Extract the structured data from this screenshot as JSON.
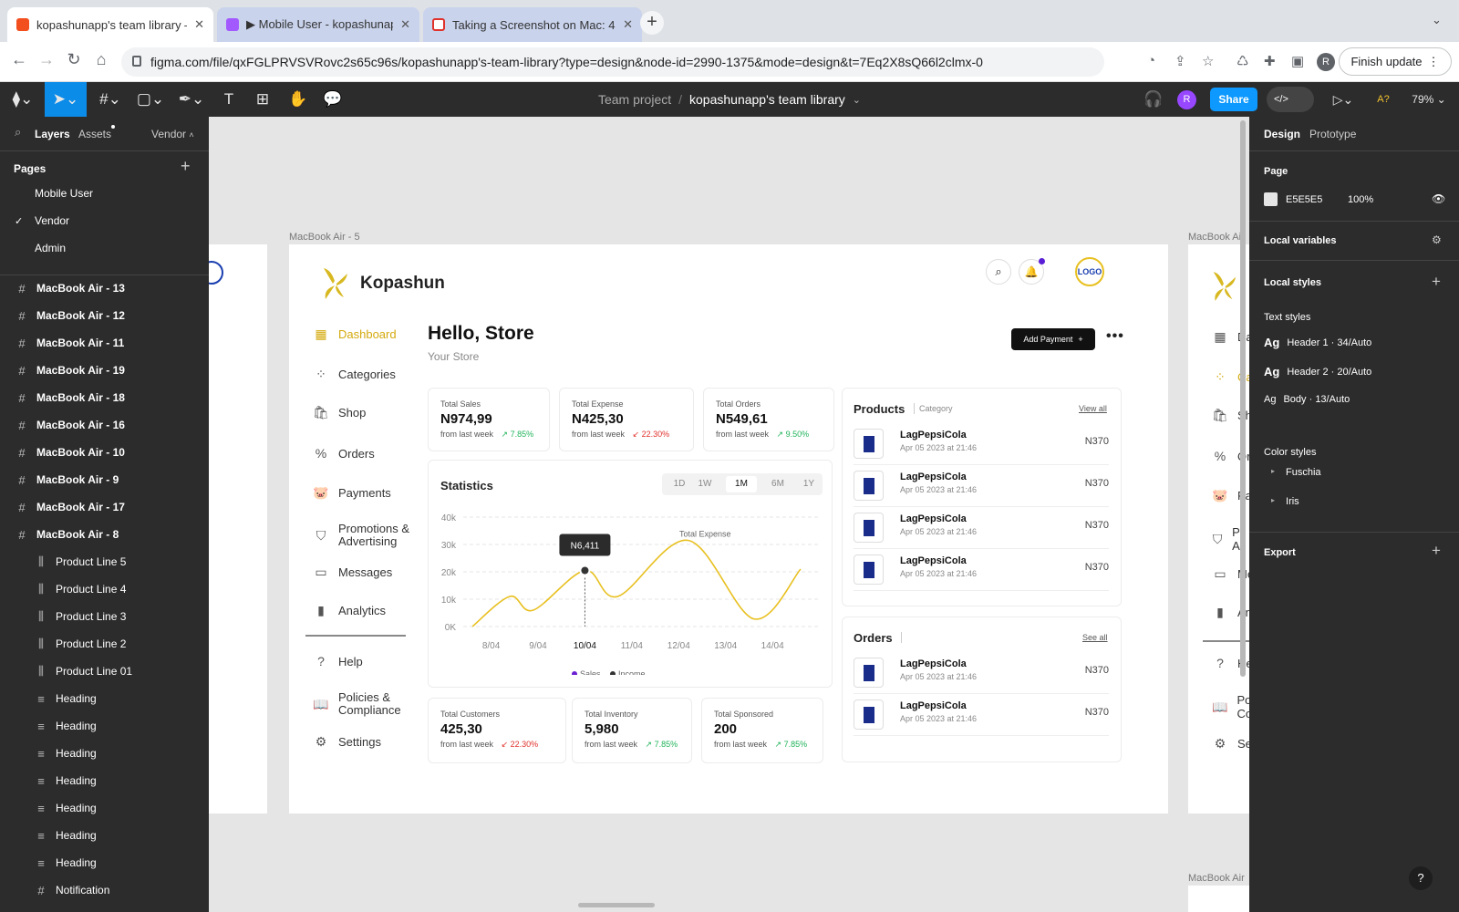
{
  "browser": {
    "tabs": [
      {
        "title": "kopashunapp's team library – F",
        "fav": "#f24e1e"
      },
      {
        "title": "▶ Mobile User - kopashunapp'",
        "fav": "#a259ff"
      },
      {
        "title": "Taking a Screenshot on Mac: 4",
        "fav": "#e0312b"
      }
    ],
    "url": "figma.com/file/qxFGLPRVSVRovc2s65c96s/kopashunapp's-team-library?type=design&node-id=2990-1375&mode=design&t=7Eq2X8sQ66l2clmx-0",
    "finish_update": "Finish update",
    "profile": "R"
  },
  "toolbar": {
    "project": "Team project",
    "separator": "/",
    "file": "kopashunapp's team library",
    "share": "Share",
    "user": "R",
    "zoom": "79%",
    "a_label": "A?"
  },
  "left_panel": {
    "tab_layers": "Layers",
    "tab_assets": "Assets",
    "page_switch": "Vendor",
    "pages_title": "Pages",
    "pages": [
      "Mobile User",
      "Vendor",
      "Admin"
    ],
    "layers": [
      {
        "name": "MacBook Air - 13",
        "type": "frame"
      },
      {
        "name": "MacBook Air - 12",
        "type": "frame"
      },
      {
        "name": "MacBook Air - 11",
        "type": "frame"
      },
      {
        "name": "MacBook Air - 19",
        "type": "frame"
      },
      {
        "name": "MacBook Air - 18",
        "type": "frame"
      },
      {
        "name": "MacBook Air - 16",
        "type": "frame"
      },
      {
        "name": "MacBook Air - 10",
        "type": "frame"
      },
      {
        "name": "MacBook Air - 9",
        "type": "frame"
      },
      {
        "name": "MacBook Air - 17",
        "type": "frame"
      },
      {
        "name": "MacBook Air - 8",
        "type": "frame"
      },
      {
        "name": "Product Line 5",
        "type": "component"
      },
      {
        "name": "Product Line 4",
        "type": "component"
      },
      {
        "name": "Product Line 3",
        "type": "component"
      },
      {
        "name": "Product Line 2",
        "type": "component"
      },
      {
        "name": "Product Line 01",
        "type": "component"
      },
      {
        "name": "Heading",
        "type": "text"
      },
      {
        "name": "Heading",
        "type": "text"
      },
      {
        "name": "Heading",
        "type": "text"
      },
      {
        "name": "Heading",
        "type": "text"
      },
      {
        "name": "Heading",
        "type": "text"
      },
      {
        "name": "Heading",
        "type": "text"
      },
      {
        "name": "Heading",
        "type": "text"
      },
      {
        "name": "Notification",
        "type": "frame"
      }
    ]
  },
  "canvas": {
    "frame_label": "MacBook Air - 5",
    "frame_label_right": "MacBook Air -",
    "frame_label_bottom": "MacBook Air -",
    "brand": "Kopashun",
    "logo_text": "LOGO",
    "greeting": "Hello, Store",
    "subtitle": "Your Store",
    "add_payment": "Add Payment",
    "nav": [
      "Dashboard",
      "Categories",
      "Shop",
      "Orders",
      "Payments",
      "Promotions & Advertising",
      "Messages",
      "Analytics"
    ],
    "nav_bottom": [
      "Help",
      "Policies & Compliance",
      "Settings"
    ],
    "right_nav_partial": [
      "Da",
      "Ca",
      "Sho",
      "Or",
      "Pa",
      "Pr Ac",
      "Me",
      "An",
      "He",
      "Po Co",
      "Se"
    ],
    "stats_top": [
      {
        "label": "Total Sales",
        "value": "N974,99",
        "from": "from last week",
        "change": "↗ 7.85%",
        "dir": "up"
      },
      {
        "label": "Total Expense",
        "value": "N425,30",
        "from": "from last week",
        "change": "↙ 22.30%",
        "dir": "dn"
      },
      {
        "label": "Total Orders",
        "value": "N549,61",
        "from": "from last week",
        "change": "↗ 9.50%",
        "dir": "up"
      }
    ],
    "stats_bottom": [
      {
        "label": "Total Customers",
        "value": "425,30",
        "from": "from last week",
        "change": "↙ 22.30%",
        "dir": "dn"
      },
      {
        "label": "Total Inventory",
        "value": "5,980",
        "from": "from last week",
        "change": "↗ 7.85%",
        "dir": "up"
      },
      {
        "label": "Total Sponsored",
        "value": "200",
        "from": "from last week",
        "change": "↗ 7.85%",
        "dir": "up"
      }
    ],
    "statistics": {
      "title": "Statistics",
      "ranges": [
        "1D",
        "1W",
        "1M",
        "6M",
        "1Y"
      ],
      "active_range": "1M",
      "tooltip": "N6,411",
      "annotation": "Total Expense",
      "legend": [
        "Sales",
        "Income"
      ]
    },
    "products": {
      "title": "Products",
      "category": "Category",
      "view_all": "View all",
      "items": [
        {
          "name": "LagPepsiCola",
          "date": "Apr 05 2023 at 21:46",
          "price": "N370"
        },
        {
          "name": "LagPepsiCola",
          "date": "Apr 05 2023 at 21:46",
          "price": "N370"
        },
        {
          "name": "LagPepsiCola",
          "date": "Apr 05 2023 at 21:46",
          "price": "N370"
        },
        {
          "name": "LagPepsiCola",
          "date": "Apr 05 2023 at 21:46",
          "price": "N370"
        }
      ]
    },
    "orders": {
      "title": "Orders",
      "see_all": "See all",
      "items": [
        {
          "name": "LagPepsiCola",
          "date": "Apr 05 2023 at 21:46",
          "price": "N370"
        },
        {
          "name": "LagPepsiCola",
          "date": "Apr 05 2023 at 21:46",
          "price": "N370"
        }
      ]
    }
  },
  "chart_data": {
    "type": "line",
    "x": [
      "8/04",
      "9/04",
      "10/04",
      "11/04",
      "12/04",
      "13/04",
      "14/04"
    ],
    "ylim": [
      0,
      40000
    ],
    "yticks": [
      "40k",
      "30k",
      "20k",
      "10k",
      "0K"
    ],
    "series": [
      {
        "name": "Sales",
        "color": "#e8c020",
        "points": [
          [
            7.6,
            0
          ],
          [
            8.4,
            11000
          ],
          [
            8.9,
            6000
          ],
          [
            10.0,
            20500
          ],
          [
            10.7,
            11000
          ],
          [
            12.2,
            31500
          ],
          [
            13.6,
            2800
          ],
          [
            14.6,
            21000
          ]
        ]
      }
    ],
    "legend_colors": [
      "#6a1fd0",
      "#333333"
    ],
    "tooltip_x": "10/04",
    "tooltip_value": "N6,411"
  },
  "right_panel": {
    "tab_design": "Design",
    "tab_prototype": "Prototype",
    "page_title": "Page",
    "page_color": "E5E5E5",
    "page_opacity": "100%",
    "local_variables": "Local variables",
    "local_styles": "Local styles",
    "text_styles_title": "Text styles",
    "text_styles": [
      {
        "ag": "Ag",
        "name": "Header 1 · 34/Auto"
      },
      {
        "ag": "Ag",
        "name": "Header 2 · 20/Auto"
      },
      {
        "ag": "Ag",
        "name": "Body · 13/Auto"
      }
    ],
    "color_styles_title": "Color styles",
    "color_styles": [
      "Fuschia",
      "Iris"
    ],
    "export": "Export",
    "help": "?"
  }
}
